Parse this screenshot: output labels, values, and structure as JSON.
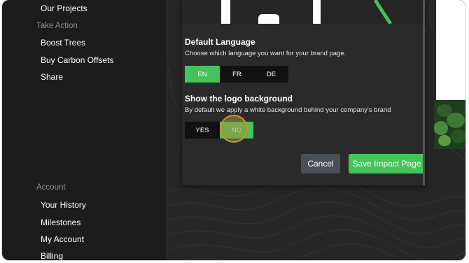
{
  "sidebar": {
    "items_top": [
      {
        "label": "Our Projects"
      }
    ],
    "section_take_action": "Take Action",
    "take_action_items": [
      {
        "label": "Boost Trees"
      },
      {
        "label": "Buy Carbon Offsets"
      },
      {
        "label": "Share"
      }
    ],
    "section_account": "Account",
    "account_items": [
      {
        "label": "Your History"
      },
      {
        "label": "Milestones"
      },
      {
        "label": "My Account"
      },
      {
        "label": "Billing"
      }
    ]
  },
  "modal": {
    "language": {
      "title": "Default Language",
      "description": "Choose which language you want for your brand page.",
      "options": [
        "EN",
        "FR",
        "DE"
      ],
      "selected": "EN"
    },
    "logo_background": {
      "title": "Show the logo background",
      "description": "By default we apply a white background behind your company's brand",
      "options": [
        "YES",
        "NO"
      ],
      "selected": "NO"
    },
    "cancel_label": "Cancel",
    "save_label": "Save Impact Page"
  },
  "colors": {
    "accent": "#43c35a",
    "sidebar_bg": "#1c1c1c",
    "modal_bg": "#2a2a2a",
    "cancel_bg": "#4a4f59",
    "highlight_ring": "#e08a2c"
  }
}
